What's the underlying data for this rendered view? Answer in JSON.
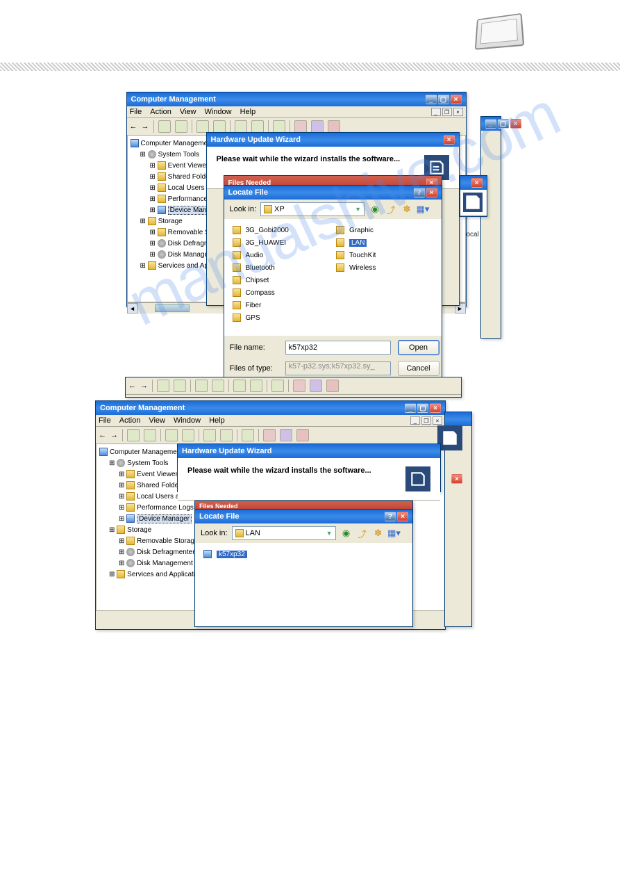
{
  "watermark": "manualshive.com",
  "s1": {
    "cm": {
      "title": "Computer Management",
      "menus": [
        "File",
        "Action",
        "View",
        "Window",
        "Help"
      ],
      "tree": [
        {
          "lvl": 0,
          "t": "Computer Management (Lo",
          "ico": "mon"
        },
        {
          "lvl": 1,
          "t": "System Tools",
          "ico": "gear"
        },
        {
          "lvl": 2,
          "t": "Event Viewer",
          "ico": "fld"
        },
        {
          "lvl": 2,
          "t": "Shared Folders",
          "ico": "fld"
        },
        {
          "lvl": 2,
          "t": "Local Users and Gro",
          "ico": "fld"
        },
        {
          "lvl": 2,
          "t": "Performance Logs a",
          "ico": "fld"
        },
        {
          "lvl": 2,
          "t": "Device Manager",
          "ico": "mon",
          "sel": true
        },
        {
          "lvl": 1,
          "t": "Storage",
          "ico": "fld"
        },
        {
          "lvl": 2,
          "t": "Removable Storage",
          "ico": "fld"
        },
        {
          "lvl": 2,
          "t": "Disk Defragmenter",
          "ico": "gear"
        },
        {
          "lvl": 2,
          "t": "Disk Management",
          "ico": "gear"
        },
        {
          "lvl": 1,
          "t": "Services and Application",
          "ico": "fld"
        }
      ]
    },
    "wiz": {
      "title": "Hardware Update Wizard",
      "msg": "Please wait while the wizard installs the software..."
    },
    "loc": {
      "title": "Locate File",
      "lookin_lbl": "Look in:",
      "lookin_val": "XP",
      "files_col1": [
        {
          "t": "3G_Gobi2000",
          "ico": "fld"
        },
        {
          "t": "3G_HUAWEI",
          "ico": "fld"
        },
        {
          "t": "Audio",
          "ico": "fld"
        },
        {
          "t": "Bluetooth",
          "ico": "fld"
        },
        {
          "t": "Chipset",
          "ico": "fld"
        },
        {
          "t": "Compass",
          "ico": "fld"
        },
        {
          "t": "Fiber",
          "ico": "fld"
        },
        {
          "t": "GPS",
          "ico": "fld"
        }
      ],
      "files_col2": [
        {
          "t": "Graphic",
          "ico": "fld"
        },
        {
          "t": "LAN",
          "ico": "fld",
          "sel": true
        },
        {
          "t": "TouchKit",
          "ico": "fld"
        },
        {
          "t": "Wireless",
          "ico": "fld"
        }
      ],
      "fn_lbl": "File name:",
      "fn_val": "k57xp32",
      "ft_lbl": "Files of type:",
      "ft_val": "k57-p32.sys;k57xp32.sy_",
      "open": "Open",
      "cancel": "Cancel"
    },
    "bg_text": "ocal"
  },
  "s2": {
    "loc": {
      "title": "Locate File",
      "lookin_lbl": "Look in:",
      "lookin_val": "LAN",
      "files": [
        {
          "t": "k57xp32",
          "ico": "inf",
          "sel": true
        }
      ]
    }
  }
}
